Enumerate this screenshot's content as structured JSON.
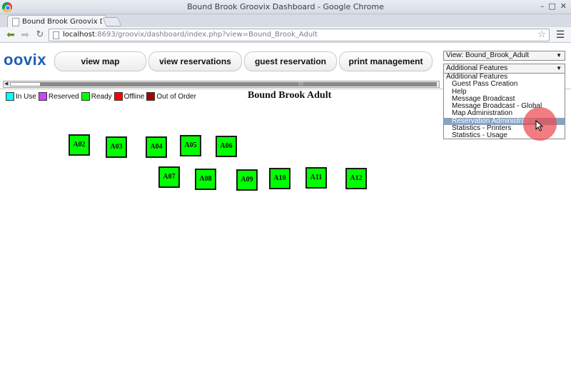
{
  "window": {
    "title": "Bound Brook Groovix Dashboard - Google Chrome"
  },
  "tab": {
    "title": "Bound Brook Groovix Dash"
  },
  "toolbar": {
    "url_host": "localhost",
    "url_path": ":8693/groovix/dashboard/index.php?view=Bound_Brook_Adult"
  },
  "app": {
    "logo": "oovix",
    "nav": [
      "view map",
      "view reservations",
      "guest reservation",
      "print management"
    ]
  },
  "view_select": {
    "value": "View: Bound_Brook_Adult"
  },
  "features_select": {
    "value": "Additional Features",
    "options": [
      "Additional Features",
      "Guest Pass Creation",
      "Help",
      "Message Broadcast",
      "Message Broadcast - Global",
      "Map Administration",
      "Reservation Administration",
      "Statistics - Printers",
      "Statistics - Usage"
    ],
    "highlighted_option": "Reservation Administration"
  },
  "legend": [
    {
      "label": "In Use",
      "color": "#00ffff"
    },
    {
      "label": "Reserved",
      "color": "#cc44ff"
    },
    {
      "label": "Ready",
      "color": "#00ff00"
    },
    {
      "label": "Offline",
      "color": "#ff0000"
    },
    {
      "label": "Out of Order",
      "color": "#aa0000"
    }
  ],
  "room": {
    "title": "Bound Brook Adult",
    "seats": [
      {
        "id": "A02",
        "status": "Ready"
      },
      {
        "id": "A03",
        "status": "Ready"
      },
      {
        "id": "A04",
        "status": "Ready"
      },
      {
        "id": "A05",
        "status": "Ready"
      },
      {
        "id": "A06",
        "status": "Ready"
      },
      {
        "id": "A07",
        "status": "Ready"
      },
      {
        "id": "A08",
        "status": "Ready"
      },
      {
        "id": "A09",
        "status": "Ready"
      },
      {
        "id": "A10",
        "status": "Ready"
      },
      {
        "id": "A11",
        "status": "Ready"
      },
      {
        "id": "A12",
        "status": "Ready"
      }
    ]
  }
}
